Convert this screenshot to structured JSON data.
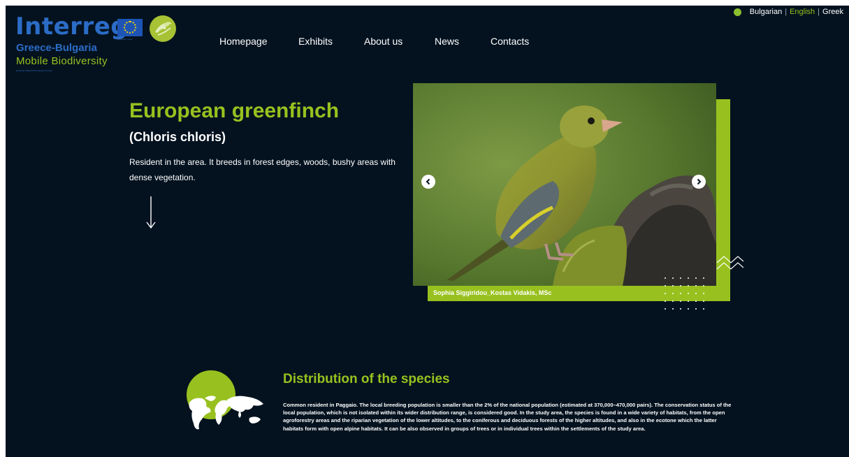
{
  "logo": {
    "brand": "Interreg",
    "region": "Greece-Bulgaria",
    "project": "Mobile Biodiversity",
    "fund": "European Regional Development Fund",
    "eu_caption": "European Union"
  },
  "nav": {
    "items": [
      "Homepage",
      "Exhibits",
      "About us",
      "News",
      "Contacts"
    ]
  },
  "languages": {
    "items": [
      "Bulgarian",
      "English",
      "Greek"
    ],
    "active": "English"
  },
  "hero": {
    "name": "European greenfinch",
    "latin": "(Chloris chloris)",
    "description": "Resident in the area. It breeds in forest edges, woods, bushy areas with dense vegetation."
  },
  "photo": {
    "credit": "Sophia Siggiridou_Kostas Vidakis, MSc"
  },
  "distribution": {
    "title": "Distribution of the species",
    "text": "Common resident in Paggaio. The local breeding population is smaller than the 2% of the national population (estimated at 370,000–470,000 pairs). The conservation status of the local population, which is not isolated within its wider distribution range, is considered good. In the study area, the species is found in a wide variety of habitats, from the open agroforestry areas and the riparian vegetation of the lower altitudes, to the coniferous and deciduous forests of the higher altitudes, and also in the ecotone which the latter habitats form with open alpine habitats. It can be also observed in groups of trees or in individual trees within the settlements of the study area."
  },
  "colors": {
    "background": "#04121f",
    "accent": "#98c11f",
    "brand_blue": "#2b6cc6"
  }
}
